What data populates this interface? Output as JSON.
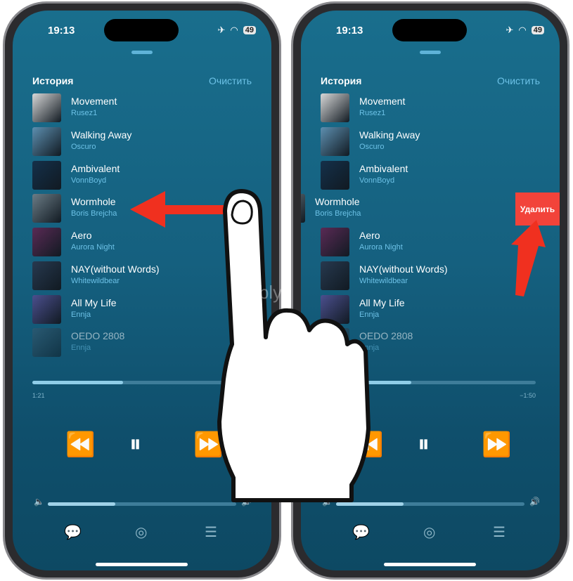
{
  "status": {
    "time": "19:13",
    "battery": "49",
    "airplane_icon": "airplane-icon",
    "wifi_icon": "wifi-icon"
  },
  "history": {
    "title": "История",
    "clear_label": "Очистить"
  },
  "tracks": [
    {
      "title": "Movement",
      "artist": "Rusez1",
      "art_color": "#d8d8d8"
    },
    {
      "title": "Walking Away",
      "artist": "Oscuro",
      "art_color": "#5d8fb0"
    },
    {
      "title": "Ambivalent",
      "artist": "VonnBoyd",
      "art_color": "#14304a"
    },
    {
      "title": "Wormhole",
      "artist": "Boris Brejcha",
      "art_color": "#6b7c86"
    },
    {
      "title": "Aero",
      "artist": "Aurora Night",
      "art_color": "#5a2a55"
    },
    {
      "title": "NAY(without Words)",
      "artist": "Whitewildbear",
      "art_color": "#27394f"
    },
    {
      "title": "All My Life",
      "artist": "Ennja",
      "art_color": "#4b4f8e"
    },
    {
      "title": "OEDO 2808",
      "artist": "Ennja",
      "art_color": "#3c5b70"
    }
  ],
  "swiped_track_index": 3,
  "delete_label": "Удалить",
  "playback": {
    "elapsed": "1:21",
    "remaining": "−1:50",
    "progress_percent": 42,
    "volume_percent": 36,
    "state": "playing"
  },
  "controls": {
    "rewind": "⏪",
    "pause": "⏸",
    "forward": "⏩"
  },
  "bottom_icons": [
    "lyrics-icon",
    "airplay-icon",
    "queue-icon"
  ],
  "watermark": "Yablyk",
  "colors": {
    "accent": "#6cc1e6",
    "delete": "#f2433a",
    "arrow": "#f0301f"
  }
}
